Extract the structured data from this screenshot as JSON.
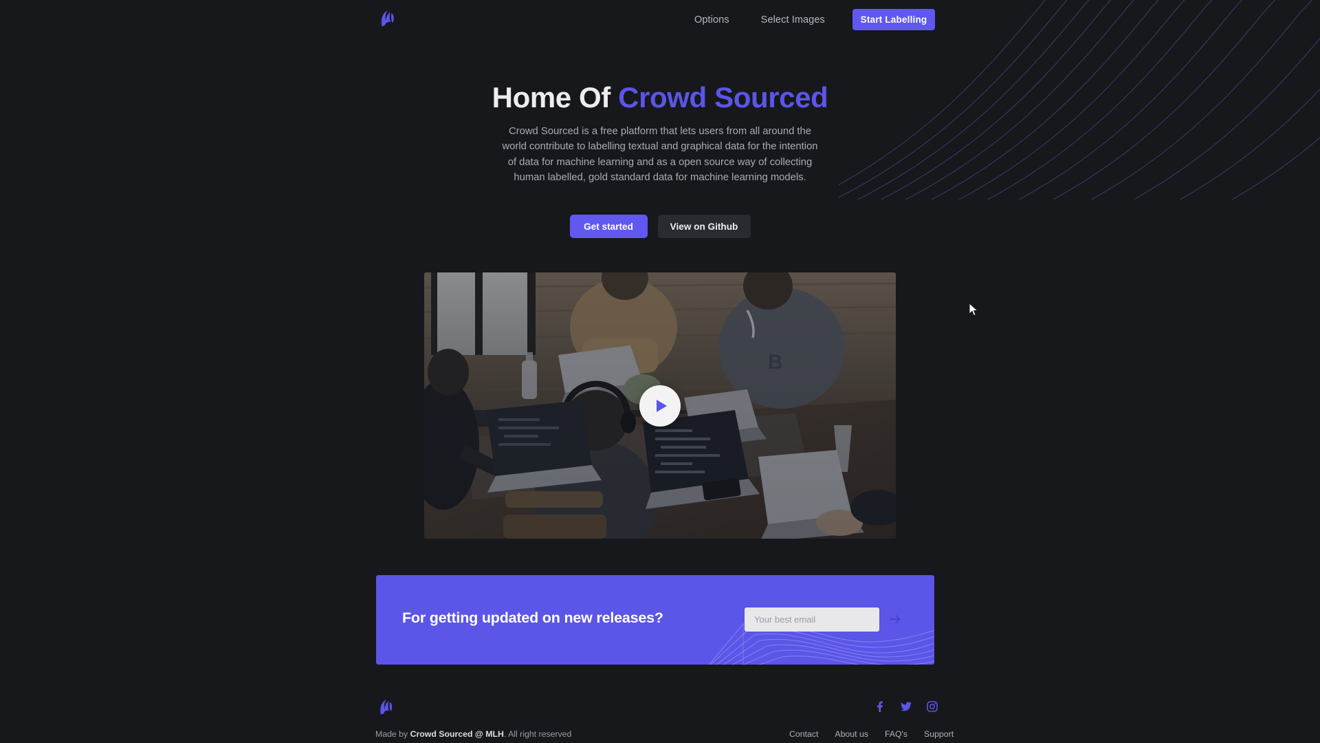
{
  "site": {
    "logo_icon": "crowd-sourced-logo-icon",
    "accent_color": "#6058f0",
    "background_color": "#17181c"
  },
  "header": {
    "nav": [
      {
        "label": "Options",
        "name": "nav-link-options"
      },
      {
        "label": "Select Images",
        "name": "nav-link-select-images"
      }
    ],
    "cta_label": "Start Labelling"
  },
  "hero": {
    "title_lead": "Home Of ",
    "title_accent": "Crowd Sourced",
    "description": "Crowd Sourced is a free platform that lets users from all around the world contribute to labelling textual and graphical data for the intention of data for machine learning and as a open source way of collecting human labelled, gold standard data for machine learning models.",
    "primary_cta": "Get started",
    "secondary_cta": "View on Github"
  },
  "video": {
    "play_icon": "play-triangle-icon",
    "alt": "Team of people working on laptops around a wooden table"
  },
  "newsletter": {
    "title": "For getting updated on new releases?",
    "email_placeholder": "Your best email",
    "email_value": "",
    "submit_icon": "arrow-right-icon"
  },
  "footer": {
    "copyright_prefix": "Made by ",
    "copyright_brand": "Crowd Sourced @ MLH",
    "copyright_suffix": ". All right reserved",
    "socials": [
      {
        "name": "facebook-icon",
        "label": "Facebook"
      },
      {
        "name": "twitter-icon",
        "label": "Twitter"
      },
      {
        "name": "instagram-icon",
        "label": "Instagram"
      }
    ],
    "links": [
      {
        "label": "Contact",
        "name": "footer-link-contact"
      },
      {
        "label": "About us",
        "name": "footer-link-about-us"
      },
      {
        "label": "FAQ's",
        "name": "footer-link-faqs"
      },
      {
        "label": "Support",
        "name": "footer-link-support"
      }
    ]
  }
}
